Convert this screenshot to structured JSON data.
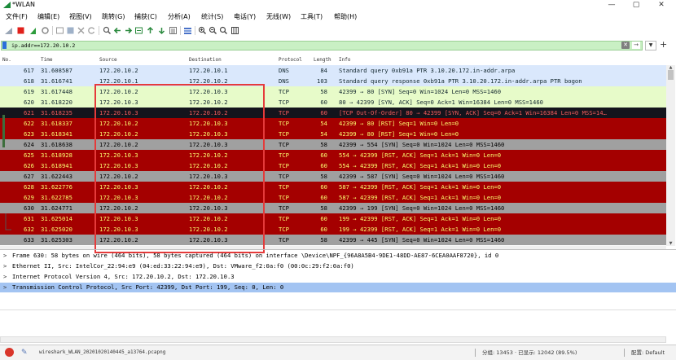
{
  "window": {
    "title": "*WLAN",
    "minimize": "—",
    "maximize": "▢",
    "close": "✕"
  },
  "menu": [
    "文件(F)",
    "编辑(E)",
    "视图(V)",
    "跳转(G)",
    "捕获(C)",
    "分析(A)",
    "统计(S)",
    "电话(Y)",
    "无线(W)",
    "工具(T)",
    "帮助(H)"
  ],
  "toolbar_icons": [
    "shark-fin-icon",
    "stop-icon",
    "restart-icon",
    "options-icon",
    "open-icon",
    "save-icon",
    "close-file-icon",
    "reload-icon",
    "find-icon",
    "back-icon",
    "forward-icon",
    "goto-icon",
    "first-icon",
    "last-icon",
    "autoscroll-icon",
    "colorize-icon",
    "zoom-in-icon",
    "zoom-out-icon",
    "zoom-reset-icon",
    "resize-columns-icon"
  ],
  "filter": {
    "value": "ip.addr==172.20.10.2",
    "clear": "✕",
    "apply": "→",
    "dropdown": "▼",
    "add": "+"
  },
  "columns": {
    "no": "No.",
    "time": "Time",
    "source": "Source",
    "destination": "Destination",
    "protocol": "Protocol",
    "length": "Length",
    "info": "Info"
  },
  "colors": {
    "dns_bg": "#dae8fc",
    "tcp_light_bg": "#e7fbc9",
    "dark_bg": "#14141c",
    "dark_fg": "#f35c5c",
    "red_bg": "#a40000",
    "red_fg": "#fbfb6f",
    "gray_bg": "#a0a0a0",
    "gray_fg": "#000000",
    "selected_bg": "#a3c4f2",
    "accent": "#e53b3b"
  },
  "packets": [
    {
      "no": "617",
      "time": "31.608587",
      "source": "172.20.10.2",
      "destination": "172.20.10.1",
      "protocol": "DNS",
      "length": "84",
      "info": "Standard query 0xb91a PTR 3.10.20.172.in-addr.arpa",
      "style": "dns"
    },
    {
      "no": "618",
      "time": "31.616741",
      "source": "172.20.10.1",
      "destination": "172.20.10.2",
      "protocol": "DNS",
      "length": "103",
      "info": "Standard query response 0xb91a PTR 3.10.20.172.in-addr.arpa PTR bogon",
      "style": "dns"
    },
    {
      "no": "619",
      "time": "31.617448",
      "source": "172.20.10.2",
      "destination": "172.20.10.3",
      "protocol": "TCP",
      "length": "58",
      "info": "42399 → 80 [SYN] Seq=0 Win=1024 Len=0 MSS=1460",
      "style": "tcp"
    },
    {
      "no": "620",
      "time": "31.618220",
      "source": "172.20.10.3",
      "destination": "172.20.10.2",
      "protocol": "TCP",
      "length": "60",
      "info": "80 → 42399 [SYN, ACK] Seq=0 Ack=1 Win=16384 Len=0 MSS=1460",
      "style": "tcp"
    },
    {
      "no": "621",
      "time": "31.618235",
      "source": "172.20.10.3",
      "destination": "172.20.10.2",
      "protocol": "TCP",
      "length": "60",
      "info": "[TCP Out-Of-Order] 80 → 42399 [SYN, ACK] Seq=0 Ack=1 Win=16384 Len=0 MSS=14…",
      "style": "dark"
    },
    {
      "no": "622",
      "time": "31.618337",
      "source": "172.20.10.2",
      "destination": "172.20.10.3",
      "protocol": "TCP",
      "length": "54",
      "info": "42399 → 80 [RST] Seq=1 Win=0 Len=0",
      "style": "red"
    },
    {
      "no": "623",
      "time": "31.618341",
      "source": "172.20.10.2",
      "destination": "172.20.10.3",
      "protocol": "TCP",
      "length": "54",
      "info": "42399 → 80 [RST] Seq=1 Win=0 Len=0",
      "style": "red"
    },
    {
      "no": "624",
      "time": "31.618638",
      "source": "172.20.10.2",
      "destination": "172.20.10.3",
      "protocol": "TCP",
      "length": "58",
      "info": "42399 → 554 [SYN] Seq=0 Win=1024 Len=0 MSS=1460",
      "style": "gray"
    },
    {
      "no": "625",
      "time": "31.618928",
      "source": "172.20.10.3",
      "destination": "172.20.10.2",
      "protocol": "TCP",
      "length": "60",
      "info": "554 → 42399 [RST, ACK] Seq=1 Ack=1 Win=0 Len=0",
      "style": "red"
    },
    {
      "no": "626",
      "time": "31.618941",
      "source": "172.20.10.3",
      "destination": "172.20.10.2",
      "protocol": "TCP",
      "length": "60",
      "info": "554 → 42399 [RST, ACK] Seq=1 Ack=1 Win=0 Len=0",
      "style": "red"
    },
    {
      "no": "627",
      "time": "31.622443",
      "source": "172.20.10.2",
      "destination": "172.20.10.3",
      "protocol": "TCP",
      "length": "58",
      "info": "42399 → 587 [SYN] Seq=0 Win=1024 Len=0 MSS=1460",
      "style": "gray"
    },
    {
      "no": "628",
      "time": "31.622776",
      "source": "172.20.10.3",
      "destination": "172.20.10.2",
      "protocol": "TCP",
      "length": "60",
      "info": "587 → 42399 [RST, ACK] Seq=1 Ack=1 Win=0 Len=0",
      "style": "red"
    },
    {
      "no": "629",
      "time": "31.622785",
      "source": "172.20.10.3",
      "destination": "172.20.10.2",
      "protocol": "TCP",
      "length": "60",
      "info": "587 → 42399 [RST, ACK] Seq=1 Ack=1 Win=0 Len=0",
      "style": "red"
    },
    {
      "no": "630",
      "time": "31.624771",
      "source": "172.20.10.2",
      "destination": "172.20.10.3",
      "protocol": "TCP",
      "length": "58",
      "info": "42399 → 199 [SYN] Seq=0 Win=1024 Len=0 MSS=1460",
      "style": "gray"
    },
    {
      "no": "631",
      "time": "31.625014",
      "source": "172.20.10.3",
      "destination": "172.20.10.2",
      "protocol": "TCP",
      "length": "60",
      "info": "199 → 42399 [RST, ACK] Seq=1 Ack=1 Win=0 Len=0",
      "style": "red"
    },
    {
      "no": "632",
      "time": "31.625020",
      "source": "172.20.10.3",
      "destination": "172.20.10.2",
      "protocol": "TCP",
      "length": "60",
      "info": "199 → 42399 [RST, ACK] Seq=1 Ack=1 Win=0 Len=0",
      "style": "red"
    },
    {
      "no": "633",
      "time": "31.625303",
      "source": "172.20.10.2",
      "destination": "172.20.10.3",
      "protocol": "TCP",
      "length": "58",
      "info": "42399 → 445 [SYN] Seq=0 Win=1024 Len=0 MSS=1460",
      "style": "gray"
    }
  ],
  "details": [
    {
      "arrow": ">",
      "text": "Frame 630: 58 bytes on wire (464 bits), 58 bytes captured (464 bits) on interface \\Device\\NPF_{96A8A5B4-9DE1-48DD-AE87-6CEA0AAF8720}, id 0",
      "selected": false
    },
    {
      "arrow": ">",
      "text": "Ethernet II, Src: IntelCor_22:94:e9 (04:ed:33:22:94:e9), Dst: VMware_f2:0a:f0 (00:0c:29:f2:0a:f0)",
      "selected": false
    },
    {
      "arrow": ">",
      "text": "Internet Protocol Version 4, Src: 172.20.10.2, Dst: 172.20.10.3",
      "selected": false
    },
    {
      "arrow": ">",
      "text": "Transmission Control Protocol, Src Port: 42399, Dst Port: 199, Seq: 0, Len: 0",
      "selected": true
    }
  ],
  "status": {
    "file": "wireshark_WLAN_20201020140445_a13764.pcapng",
    "stats": "分组: 13453 · 已显示: 12042 (89.5%)",
    "profile": "配置: Default"
  }
}
